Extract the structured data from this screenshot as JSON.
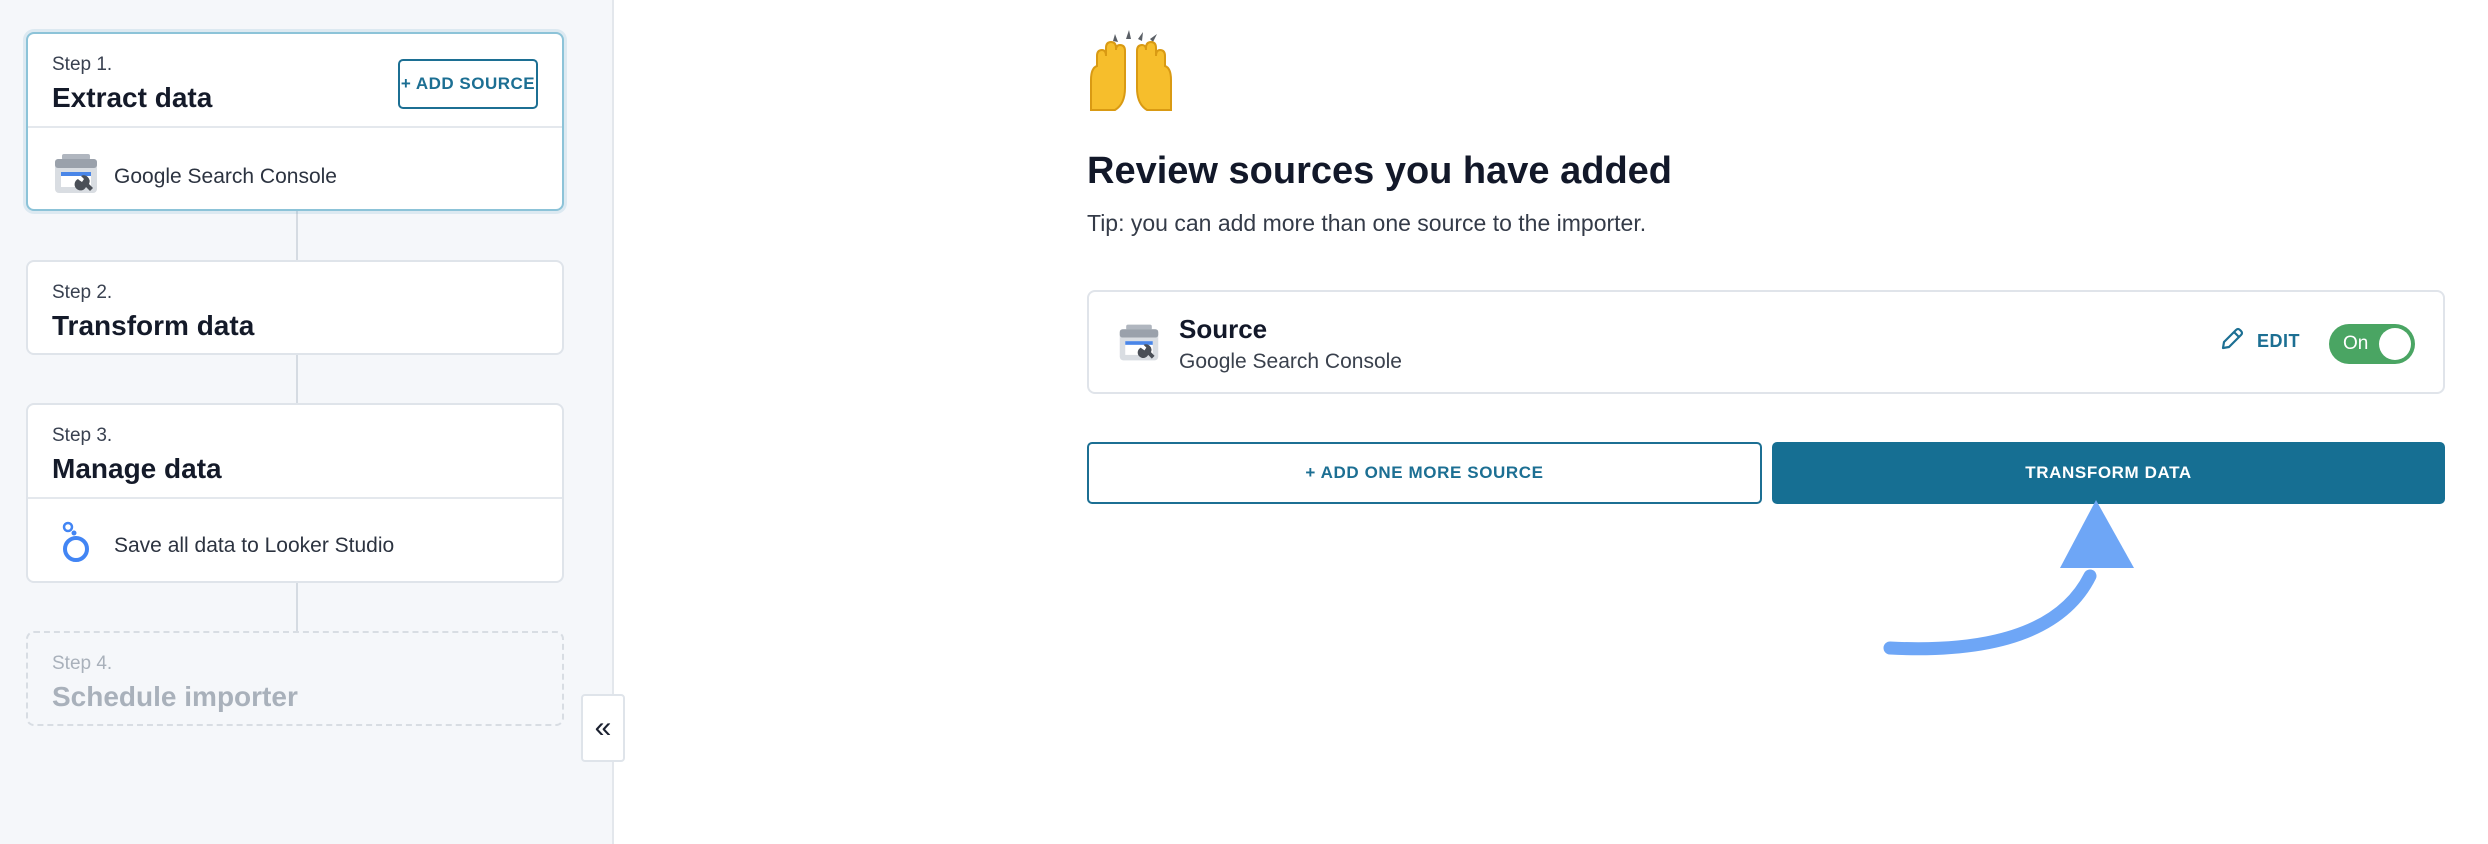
{
  "sidebar": {
    "steps": [
      {
        "num": "Step 1.",
        "title": "Extract data",
        "item_label": "Google Search Console",
        "button": "+ ADD SOURCE"
      },
      {
        "num": "Step 2.",
        "title": "Transform data"
      },
      {
        "num": "Step 3.",
        "title": "Manage data",
        "item_label": "Save all data to Looker Studio"
      },
      {
        "num": "Step 4.",
        "title": "Schedule importer"
      }
    ],
    "collapse_label": "«"
  },
  "main": {
    "emoji": "🙌",
    "title": "Review sources you have added",
    "tip": "Tip: you can add more than one source to the importer.",
    "source": {
      "title": "Source",
      "subtitle": "Google Search Console",
      "edit_label": "EDIT",
      "toggle_label": "On",
      "toggle_on": true
    },
    "add_more_label": "+ ADD ONE MORE SOURCE",
    "transform_label": "TRANSFORM DATA"
  },
  "colors": {
    "accent": "#166f93",
    "toggle_on": "#4aa563",
    "arrow": "#6ea6f6"
  }
}
